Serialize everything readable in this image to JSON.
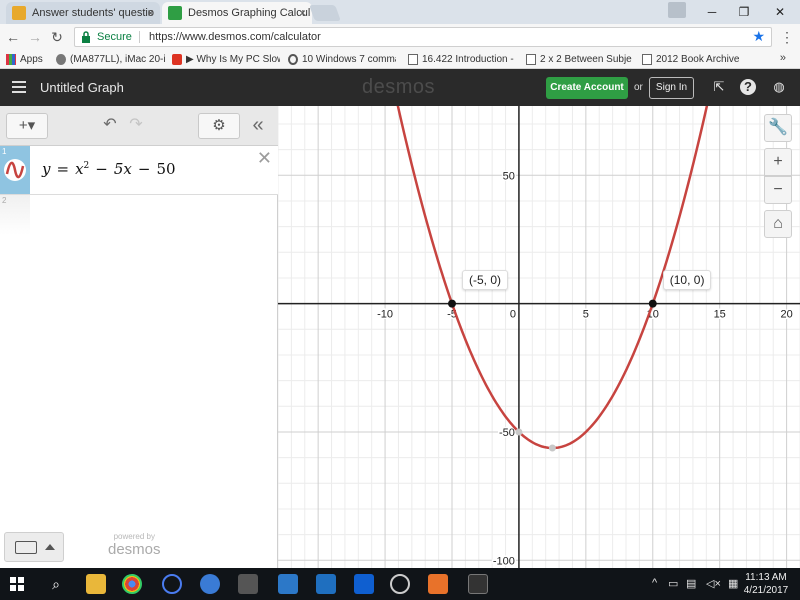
{
  "browser": {
    "tabs": [
      {
        "title": "Answer students' questio",
        "active": false,
        "favicon_color": "#e8a92c"
      },
      {
        "title": "Desmos Graphing Calcul",
        "active": true,
        "favicon_color": "#2f9e44"
      }
    ],
    "address": {
      "secure_label": "Secure",
      "url": "https://www.desmos.com/calculator"
    },
    "bookmarks": [
      {
        "label": "Apps",
        "icon": "apps-grid-icon"
      },
      {
        "label": "(MA877LL), iMac 20-i",
        "icon": "apple-icon"
      },
      {
        "label": "▶ Why Is My PC Slow",
        "icon": "power-icon"
      },
      {
        "label": "10 Windows 7 comma",
        "icon": "wave-icon"
      },
      {
        "label": "16.422 Introduction -",
        "icon": "page-icon"
      },
      {
        "label": "2 x 2 Between Subject",
        "icon": "page-icon"
      },
      {
        "label": "2012 Book Archive",
        "icon": "page-icon"
      }
    ],
    "bookmarks_more": "»"
  },
  "desmos": {
    "graph_title": "Untitled Graph",
    "logo": "desmos",
    "create_account": "Create Account",
    "or": "or",
    "sign_in": "Sign In",
    "expression_panel": {
      "expressions": [
        {
          "number": "1",
          "latex_display": {
            "lhs": "y",
            "eq": "=",
            "x": "x",
            "exp": "2",
            "minus1": "−",
            "term2": "5x",
            "minus2": "−",
            "const": "50"
          }
        },
        {
          "number": "2"
        }
      ],
      "powered_by": "powered by",
      "powered_logo": "desmos"
    },
    "curve_color": "#c74440"
  },
  "chart_data": {
    "type": "line",
    "title": "",
    "expression": "y = x^2 - 5x - 50",
    "xlim": [
      -18,
      21
    ],
    "ylim": [
      -103,
      77
    ],
    "grid": true,
    "x_ticks": [
      -10,
      -5,
      0,
      5,
      10,
      15,
      20
    ],
    "x_tick_labels": [
      "-10",
      "-5",
      "0",
      "5",
      "10",
      "15",
      "20"
    ],
    "y_ticks": [
      50,
      -50,
      -100
    ],
    "y_tick_labels": [
      "50",
      "-50",
      "-100"
    ],
    "points_of_interest": [
      {
        "x": -5,
        "y": 0,
        "label": "(-5, 0)"
      },
      {
        "x": 10,
        "y": 0,
        "label": "(10, 0)"
      },
      {
        "x": 0,
        "y": -50,
        "label": ""
      },
      {
        "x": 2.5,
        "y": -56.25,
        "label": ""
      }
    ]
  },
  "taskbar": {
    "time": "11:13 AM",
    "date": "4/21/2017"
  }
}
